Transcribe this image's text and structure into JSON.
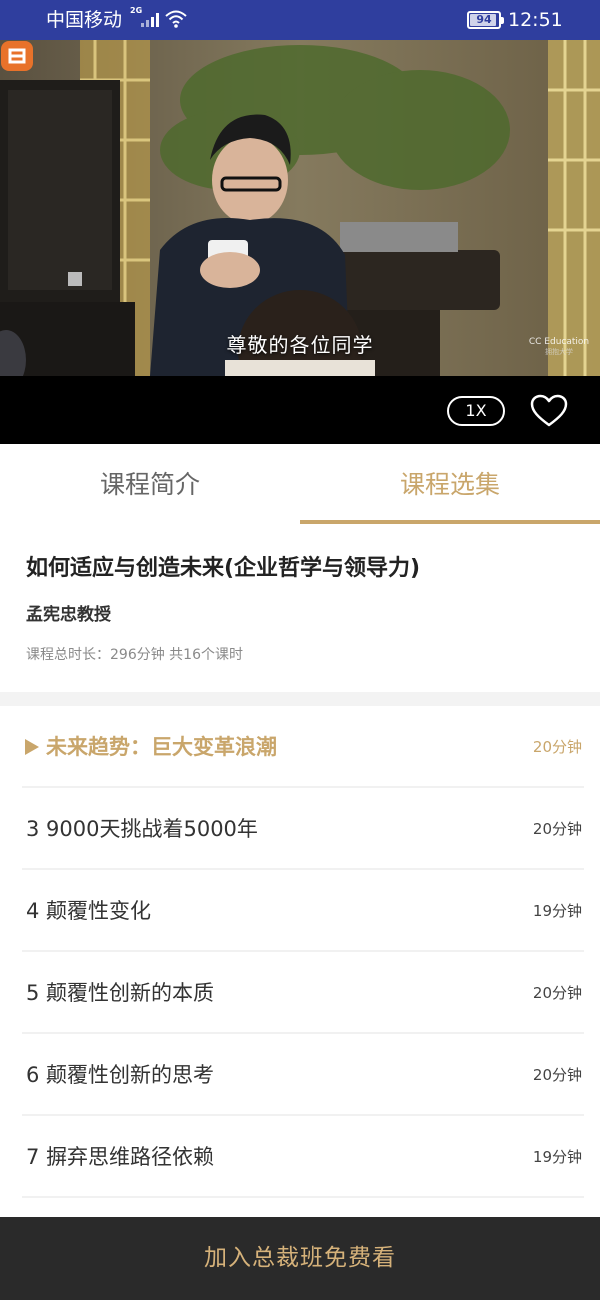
{
  "status_bar": {
    "carrier": "中国移动",
    "network_type": "2G",
    "battery": "94",
    "battery_level": 0.94,
    "time": "12:51"
  },
  "video": {
    "subtitle": "尊敬的各位同学",
    "watermark": "CC Education",
    "watermark_sub": "拥抱大学"
  },
  "player": {
    "speed_label": "1X",
    "favorite_icon": "heart-outline-icon"
  },
  "tabs": [
    {
      "label": "课程简介",
      "active": false
    },
    {
      "label": "课程选集",
      "active": true
    }
  ],
  "course": {
    "title": "如何适应与创造未来(企业哲学与领导力)",
    "teacher": "孟宪忠教授",
    "meta": "课程总时长：296分钟 共16个课时"
  },
  "episodes": [
    {
      "title": "未来趋势：巨大变革浪潮",
      "duration": "20分钟",
      "active": true
    },
    {
      "title": "3 9000天挑战着5000年",
      "duration": "20分钟",
      "active": false
    },
    {
      "title": "4 颠覆性变化",
      "duration": "19分钟",
      "active": false
    },
    {
      "title": "5 颠覆性创新的本质",
      "duration": "20分钟",
      "active": false
    },
    {
      "title": "6 颠覆性创新的思考",
      "duration": "20分钟",
      "active": false
    },
    {
      "title": "7 摒弃思维路径依赖",
      "duration": "19分钟",
      "active": false
    }
  ],
  "cta": {
    "label": "加入总裁班免费看"
  },
  "colors": {
    "status_bar": "#2f3e9e",
    "accent_gold": "#c9a66b",
    "cta_background": "#2a2a2a",
    "cta_text": "#d6b27a"
  }
}
